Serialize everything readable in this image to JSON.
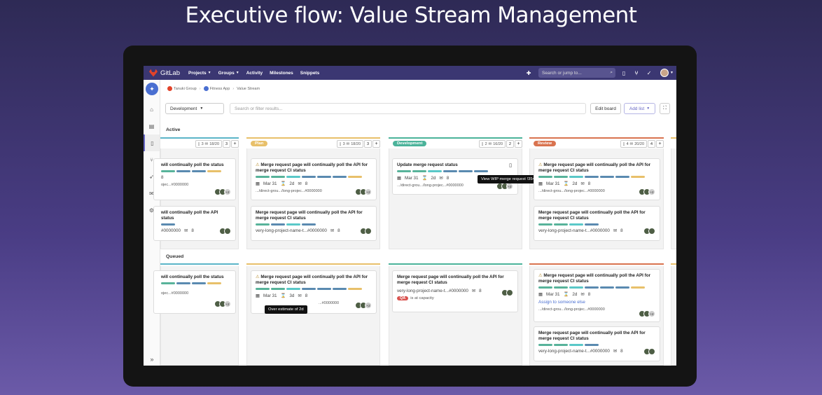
{
  "headline": "Executive flow: Value Stream Management",
  "nav": {
    "brand": "GitLab",
    "items": [
      {
        "label": "Projects",
        "caret": true
      },
      {
        "label": "Groups",
        "caret": true
      },
      {
        "label": "Activity",
        "caret": false
      },
      {
        "label": "Milestones",
        "caret": false
      },
      {
        "label": "Snippets",
        "caret": false
      }
    ],
    "search_placeholder": "Search or jump to..."
  },
  "breadcrumb": [
    "Tanuki Group",
    "Fitness App",
    "Value Stream"
  ],
  "toolbar": {
    "board_select": "Development",
    "filter_placeholder": "Search or filter results...",
    "edit_board": "Edit board",
    "add_list": "Add list"
  },
  "sections": {
    "active": "Active",
    "queued": "Queued"
  },
  "columns": [
    {
      "name": "",
      "stats_mr": "3",
      "stats_issues": "18/20",
      "count": "3",
      "color": "#5bb5c8"
    },
    {
      "name": "Plan",
      "stats_mr": "3",
      "stats_issues": "18/20",
      "count": "3",
      "color": "#e8c06a"
    },
    {
      "name": "Development",
      "stats_mr": "2",
      "stats_issues": "16/20",
      "count": "2",
      "color": "#4bb39a"
    },
    {
      "name": "Review",
      "stats_mr": "4",
      "stats_issues": "20/20",
      "count": "4",
      "color": "#d9734f"
    }
  ],
  "cards": {
    "c0a": {
      "title": "will continually poll the status",
      "meta_date": "",
      "count": "8",
      "ref": "ojec...#0000000"
    },
    "c0b": {
      "title": "will continually poll the API status",
      "ref": "#0000000",
      "comments": "8"
    },
    "c1a": {
      "title": "Merge request page will continually poll the API for merge request CI status",
      "date": "Mar 31",
      "days": "2d",
      "comments": "8",
      "ref": ".../direct-grou.../long-projec...#0000000",
      "more": "+2"
    },
    "c1b": {
      "title": "Merge request page will continually poll the API for merge request CI status",
      "ref": "very-long-project-name-t...#0000000",
      "comments": "8"
    },
    "c2a": {
      "title": "Update merge request status",
      "date": "Mar 31",
      "days": "2d",
      "comments": "8",
      "ref": ".../direct-grou.../long-projec...#0000000",
      "more": "+2"
    },
    "c3a": {
      "title": "Merge request page will continually poll the API for merge request CI status",
      "date": "Mar 31",
      "days": "2d",
      "comments": "8",
      "ref": ".../direct-grou.../long-projec...#0000000",
      "more": "+2"
    },
    "c3b": {
      "title": "Merge request page will continually poll the API for merge request CI status",
      "ref": "very-long-project-name-t...#0000000",
      "comments": "8"
    },
    "q0a": {
      "title": "will continually poll the status",
      "ref": "ojec...#0000000",
      "more": "+2"
    },
    "q1a": {
      "title": "Merge request page will continually poll the API for merge request CI status",
      "date": "Mar 31",
      "days": "3d",
      "comments": "8",
      "ref": "...#0000000",
      "more": "+2"
    },
    "q2a": {
      "title": "Merge request page will continually poll the API for merge request CI status",
      "ref": "very-long-project-name-t...#0000000",
      "comments": "8",
      "qa": "QA",
      "qa_text": "is at capacity"
    },
    "q3a": {
      "title": "Merge request page will continually poll the API for merge request CI status",
      "date": "Mar 31",
      "days": "2d",
      "comments": "8",
      "assign": "Assign to someone else",
      "ref": ".../direct-grou.../long-projec...#0000000",
      "more": "+2"
    },
    "q3b": {
      "title": "Merge request page will continually poll the API for merge request CI status",
      "ref": "very-long-project-name-t...#0000000",
      "comments": "8"
    }
  },
  "tooltips": {
    "wip": "View WIP merge request !3543",
    "estimate": "Over estimate of 2d"
  },
  "label_colors": [
    "#58b39a",
    "#5a8ab0",
    "#5ac8c8",
    "#e8c06a"
  ]
}
